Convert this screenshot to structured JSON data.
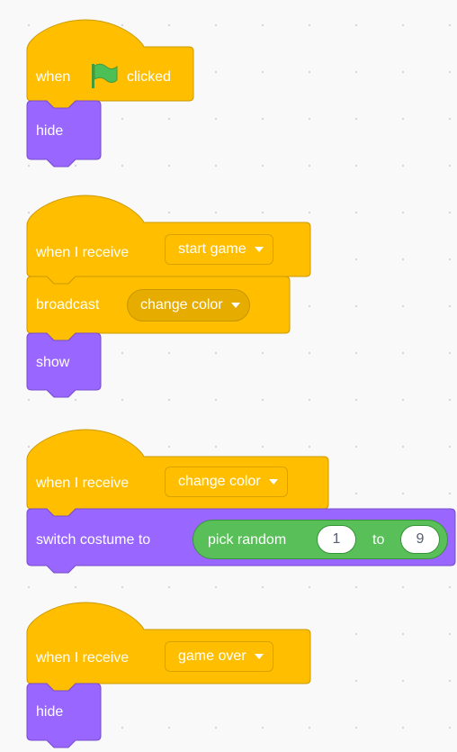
{
  "scripts": [
    {
      "hat": {
        "when": "when",
        "flag": "green-flag-icon",
        "clicked": "clicked"
      },
      "stack": [
        {
          "label": "hide"
        }
      ]
    },
    {
      "hat": {
        "label": "when I receive",
        "message": "start game"
      },
      "stack": [
        {
          "label": "broadcast",
          "message": "change color"
        },
        {
          "label": "show"
        }
      ]
    },
    {
      "hat": {
        "label": "when I receive",
        "message": "change color"
      },
      "stack": [
        {
          "label": "switch costume to",
          "reporter": {
            "label": "pick random",
            "from": "1",
            "to_label": "to",
            "to": "9"
          }
        }
      ]
    },
    {
      "hat": {
        "label": "when I receive",
        "message": "game over"
      },
      "stack": [
        {
          "label": "hide"
        }
      ]
    }
  ],
  "colors": {
    "events": "#ffbf00",
    "events_border": "#cc9900",
    "looks": "#9966ff",
    "looks_border": "#774dcb",
    "operators": "#59c059",
    "canvas": "#f9f9f9",
    "flag": "#4cbf56"
  }
}
